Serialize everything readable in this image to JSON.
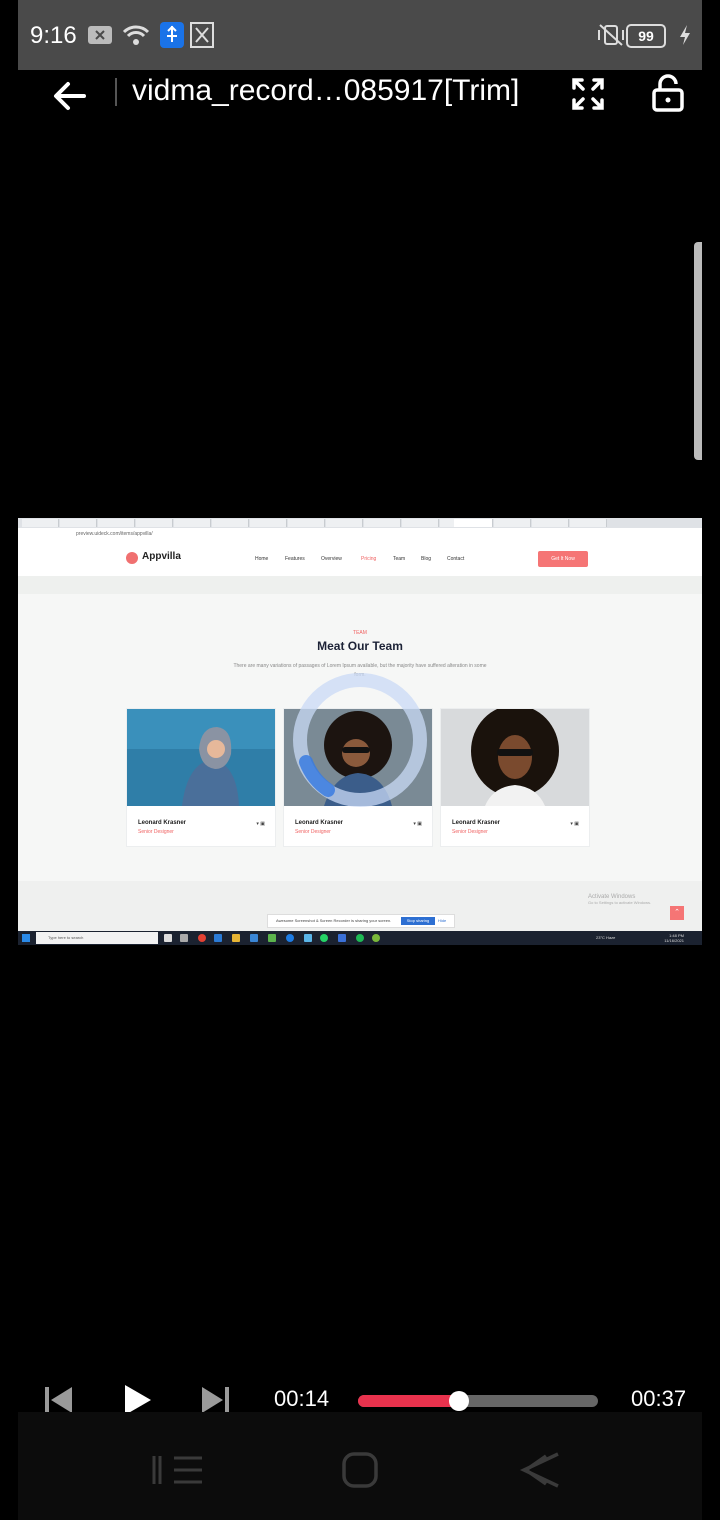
{
  "status_bar": {
    "time": "9:16",
    "battery": "99",
    "icons": [
      "close-notification-icon",
      "wifi-icon",
      "usb-icon",
      "video-trim-icon",
      "vibrate-off-icon",
      "charging-icon"
    ]
  },
  "header": {
    "title": "vidma_record…085917[Trim]",
    "icons": [
      "back-arrow-icon",
      "fullscreen-icon",
      "unlock-icon"
    ]
  },
  "video_frame": {
    "address": "preview.uideck.com/items/appvilla/",
    "brand": "Appvilla",
    "nav_items": [
      "Home",
      "Features",
      "Overview",
      "Pricing",
      "Team",
      "Blog",
      "Contact"
    ],
    "active_nav": "Pricing",
    "cta": "Get It Now",
    "eyebrow": "TEAM",
    "heading": "Meat Our Team",
    "description": "There are many variations of passages of Lorem Ipsum available, but the majority have suffered alteration in some form.",
    "cards": [
      {
        "name": "Leonard Krasner",
        "role": "Senior Designer"
      },
      {
        "name": "Leonard Krasner",
        "role": "Senior Designer"
      },
      {
        "name": "Leonard Krasner",
        "role": "Senior Designer"
      }
    ],
    "share_bar": {
      "text": "Awesome Screenshot & Screen Recorder is sharing your screen.",
      "stop": "Stop sharing",
      "hide": "Hide"
    },
    "watermark": {
      "title": "Activate Windows",
      "subtitle": "Go to Settings to activate Windows."
    },
    "taskbar": {
      "search": "Type here to search",
      "weather": "23°C Haze",
      "clock": "1:48 PM",
      "date": "11/16/2021"
    }
  },
  "player": {
    "current_time": "00:14",
    "total_time": "00:37",
    "progress": 0.42,
    "accent": "#e8324d",
    "buttons": [
      "previous-icon",
      "play-icon",
      "next-icon"
    ]
  },
  "system_nav": [
    "recents-icon",
    "home-icon",
    "back-icon"
  ]
}
